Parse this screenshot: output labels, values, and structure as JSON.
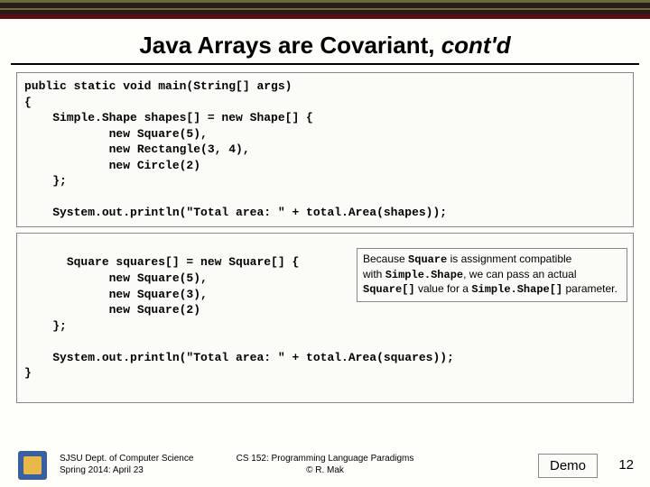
{
  "title": {
    "main": "Java Arrays are Covariant, ",
    "tail": "cont'd"
  },
  "code1": "public static void main(String[] args)\n{\n    Simple.Shape shapes[] = new Shape[] {\n            new Square(5),\n            new Rectangle(3, 4),\n            new Circle(2)\n    };\n\n    System.out.println(\"Total area: \" + total.Area(shapes));",
  "code2": "    Square squares[] = new Square[] {\n            new Square(5),\n            new Square(3),\n            new Square(2)\n    };\n\n    System.out.println(\"Total area: \" + total.Area(squares));\n}",
  "callout": {
    "p1a": "Because ",
    "p1b": "Square",
    "p1c": " is assignment compatible",
    "p2a": "with ",
    "p2b": "Simple.Shape",
    "p2c": ", we can pass an actual",
    "p3a": "Square[]",
    "p3b": " value for a ",
    "p3c": "Simple.Shape[]",
    "p3d": " parameter."
  },
  "footer": {
    "left1": "SJSU Dept. of Computer Science",
    "left2": "Spring 2014: April 23",
    "center1": "CS 152: Programming Language Paradigms",
    "center2": "© R. Mak",
    "demo": "Demo",
    "page": "12"
  }
}
